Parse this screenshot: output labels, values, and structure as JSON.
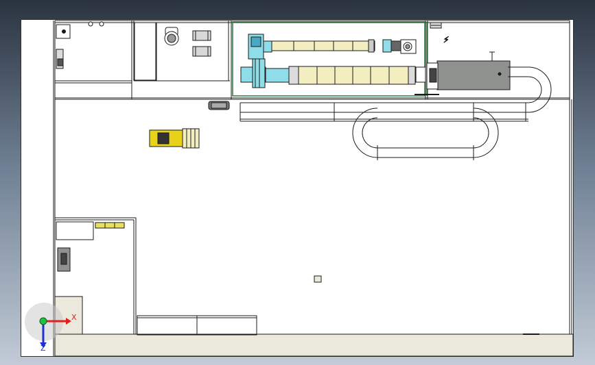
{
  "window": {
    "title": ""
  },
  "triad": {
    "x_label": "X",
    "z_label": "Z",
    "x_color": "#e02020",
    "z_color": "#2030d0",
    "origin_color": "#20c040"
  },
  "colors": {
    "yellow_fill": "#f3eec0",
    "cyan_fill": "#8fdde8",
    "gray_fill": "#8f918f",
    "floor_fill": "#ebe8dc",
    "line": "#1a1a1a"
  }
}
